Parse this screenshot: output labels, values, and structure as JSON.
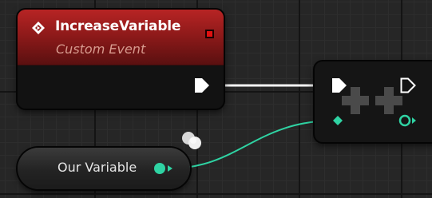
{
  "event_node": {
    "title": "IncreaseVariable",
    "subtitle": "Custom Event",
    "header_color": "#a11f1f",
    "icon": "custom-event-icon"
  },
  "increment_node": {
    "symbol": "++",
    "icon": "increment-icon"
  },
  "variable_node": {
    "label": "Our Variable",
    "type_color": "#2fd3a3"
  },
  "colors": {
    "exec_wire": "#ffffff",
    "integer_wire": "#2fd3a3",
    "background": "#262626"
  }
}
